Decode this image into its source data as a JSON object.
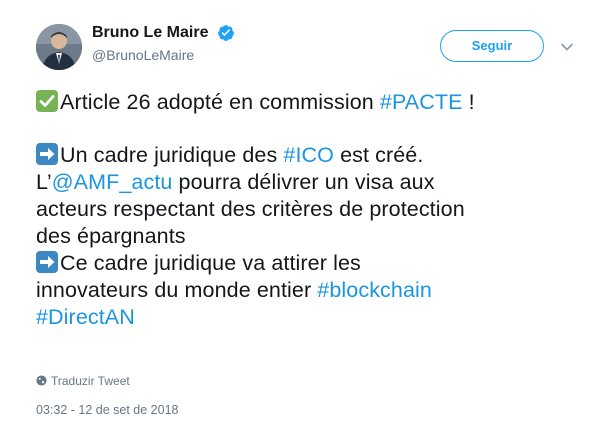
{
  "author": {
    "name": "Bruno Le Maire",
    "handle": "@BrunoLeMaire",
    "verified": true
  },
  "actions": {
    "follow_label": "Seguir"
  },
  "tweet": {
    "line1_text": "Article 26 adopté en commission ",
    "line1_hashtag": "#PACTE",
    "line1_end": " !",
    "line2_text": "Un cadre juridique des ",
    "line2_hashtag": "#ICO",
    "line2_end": " est créé.",
    "line3_start": "L’",
    "line3_mention": "@AMF_actu",
    "line3_end": " pourra délivrer un visa aux",
    "line4": "acteurs respectant des critères de protection",
    "line5": "des épargnants",
    "line6": "Ce cadre juridique va attirer les",
    "line7_text": "innovateurs du monde entier ",
    "line7_hashtag": "#blockchain",
    "line8_hashtag": "#DirectAN"
  },
  "footer": {
    "translate_label": "Traduzir Tweet",
    "timestamp": "03:32 - 12 de set de 2018"
  },
  "colors": {
    "link": "#1b95e0",
    "accent": "#1da1f2",
    "secondary_text": "#657786",
    "check_emoji_bg": "#77b255",
    "arrow_emoji_bg": "#3b88c3"
  },
  "icons": {
    "verified": "verified-badge-icon",
    "chevron": "chevron-down-icon",
    "globe": "globe-icon",
    "check_emoji": "check-mark-button-emoji",
    "arrow_emoji": "right-arrow-emoji"
  }
}
